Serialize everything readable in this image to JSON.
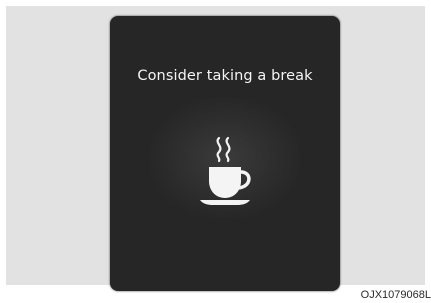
{
  "display": {
    "message": "Consider taking a break",
    "icon": "coffee-cup-icon"
  },
  "figure": {
    "code": "OJX1079068L"
  }
}
